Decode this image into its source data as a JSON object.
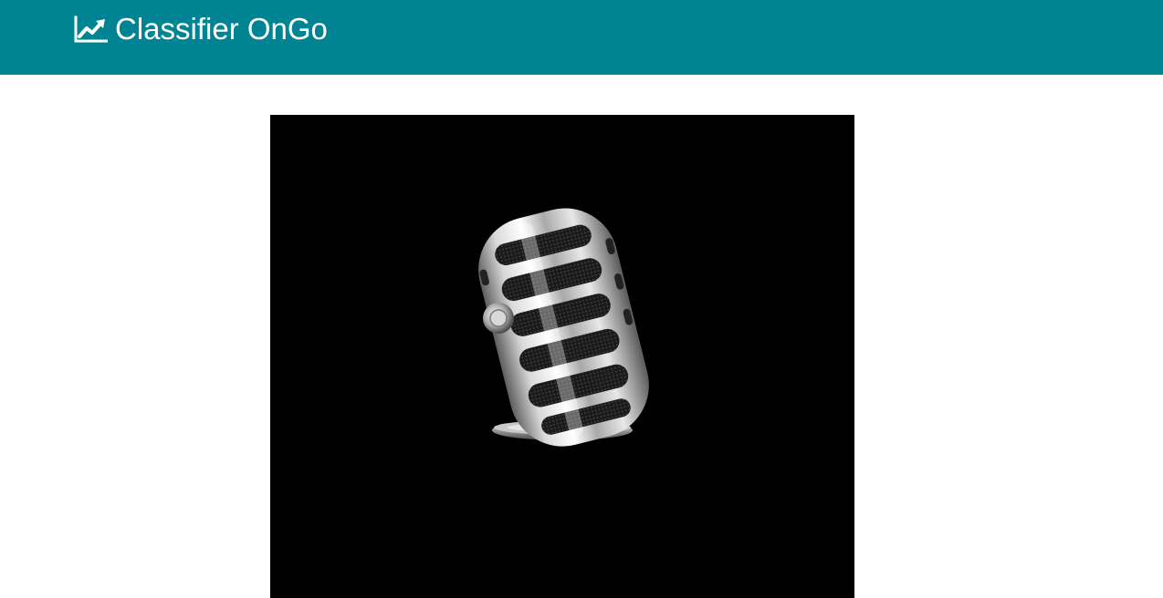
{
  "header": {
    "brand_icon": "line-chart-icon",
    "title": "Classifier OnGo",
    "background_color": "#008493",
    "text_color": "#ffffff"
  },
  "main": {
    "image": {
      "subject_icon": "microphone-icon",
      "background_color": "#000000"
    }
  }
}
